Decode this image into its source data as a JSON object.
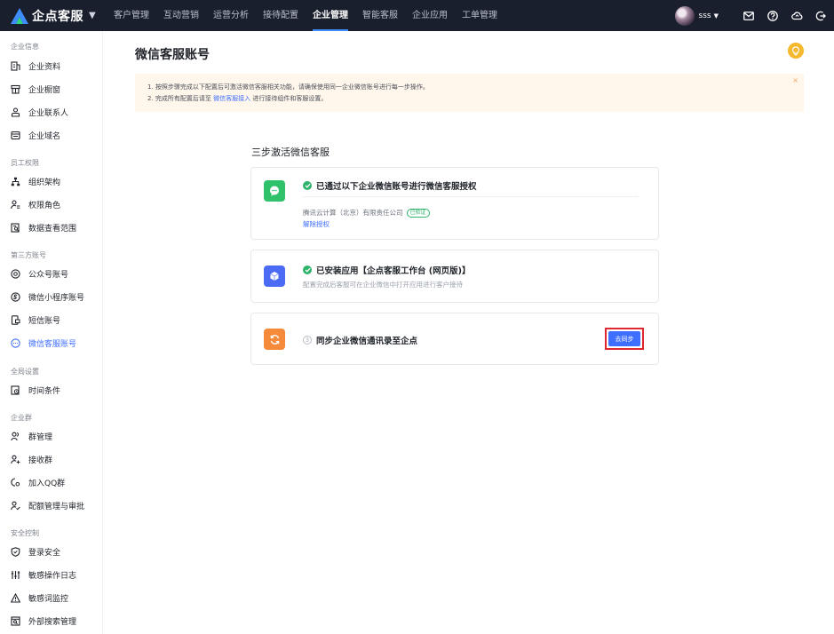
{
  "brand": {
    "name": "企点客服"
  },
  "nav": {
    "items": [
      "客户管理",
      "互动营销",
      "运营分析",
      "接待配置",
      "企业管理",
      "智能客服",
      "企业应用",
      "工单管理"
    ],
    "active_index": 4
  },
  "user": {
    "name": "sss"
  },
  "sidebar": {
    "groups": [
      {
        "title": "企业信息",
        "items": [
          "企业资料",
          "企业橱窗",
          "企业联系人",
          "企业域名"
        ]
      },
      {
        "title": "员工权限",
        "items": [
          "组织架构",
          "权限角色",
          "数据查看范围"
        ]
      },
      {
        "title": "第三方账号",
        "items": [
          "公众号账号",
          "微信小程序账号",
          "短信账号",
          "微信客服账号"
        ]
      },
      {
        "title": "全局设置",
        "items": [
          "时间条件"
        ]
      },
      {
        "title": "企业群",
        "items": [
          "群管理",
          "接收群",
          "加入QQ群",
          "配额管理与审批"
        ]
      },
      {
        "title": "安全控制",
        "items": [
          "登录安全",
          "敏感操作日志",
          "敏感词监控",
          "外部搜索管理"
        ]
      }
    ],
    "active": "微信客服账号"
  },
  "page": {
    "title": "微信客服账号",
    "notice": {
      "line1": "1. 按照步骤完成以下配置后可激活微信客服相关功能，请确保使用同一企业微信账号进行每一步操作。",
      "line2_prefix": "2. 完成所有配置后请至",
      "line2_link": "微信客服接入",
      "line2_suffix": "进行接待组件和客服设置。",
      "close": "×"
    },
    "steps_title": "三步激活微信客服",
    "step1": {
      "title": "已通过以下企业微信账号进行微信客服授权",
      "company": "腾讯云计算（北京）有限责任公司",
      "badge": "已验证",
      "action": "解除授权"
    },
    "step2": {
      "title": "已安装应用【企点客服工作台 (网页版)】",
      "desc": "配置完成后客服可在企业微信中打开应用进行客户接待"
    },
    "step3": {
      "num": "3",
      "title": "同步企业微信通讯录至企点",
      "button": "去同步"
    }
  },
  "colors": {
    "accent": "#3f6fff",
    "success": "#2db36a",
    "warning_bg": "#fff7ec",
    "nav_bg": "#1a1f2e",
    "highlight": "#e0262f"
  }
}
